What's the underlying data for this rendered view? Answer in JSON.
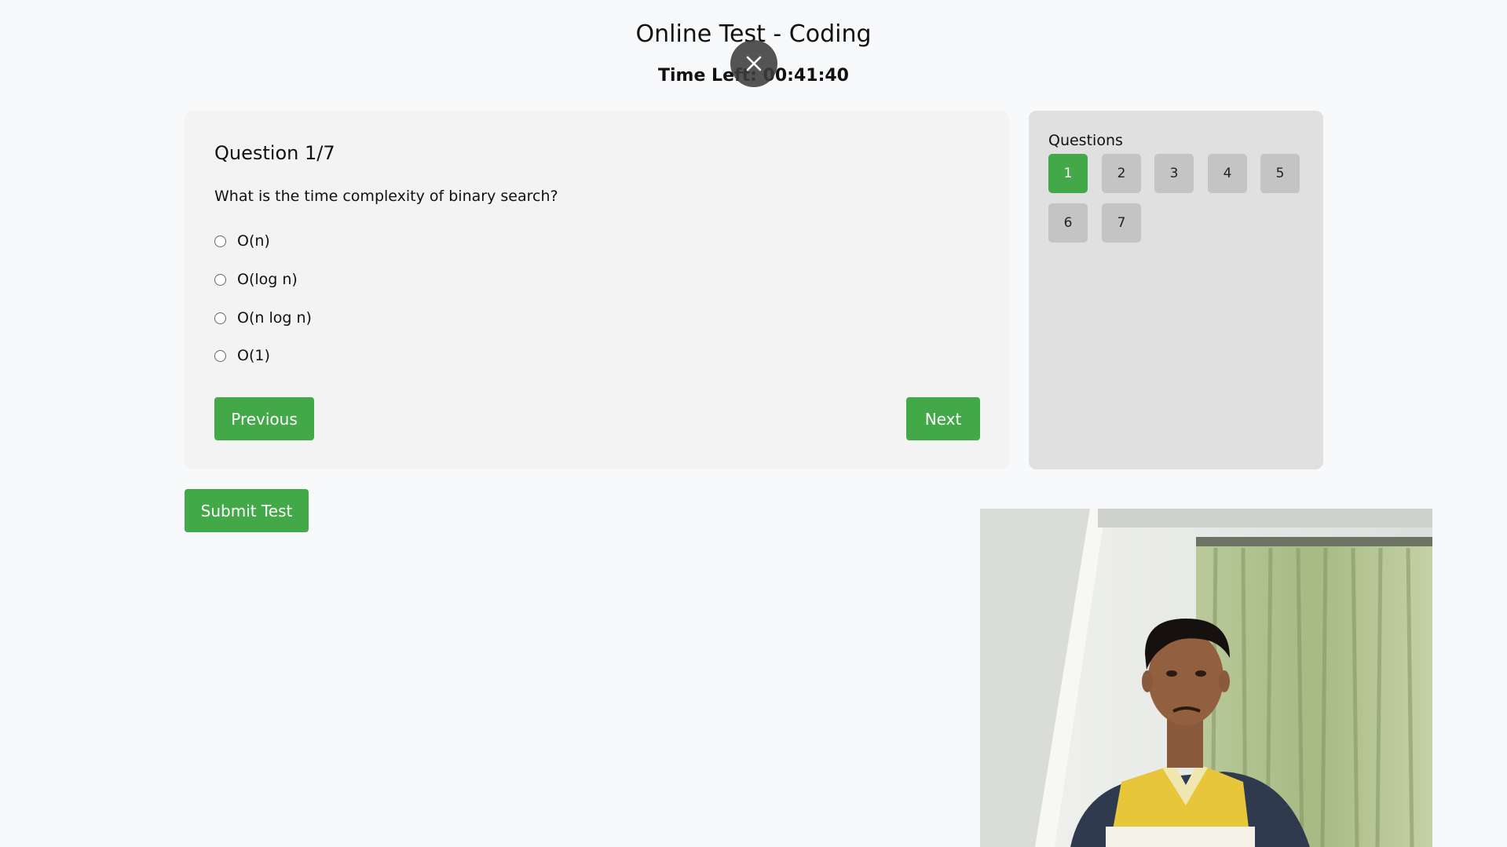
{
  "header": {
    "title": "Online Test - Coding",
    "timer": "Time Left: 00:41:40"
  },
  "question": {
    "number_label": "Question 1/7",
    "text": "What is the time complexity of binary search?",
    "options": [
      "O(n)",
      "O(log n)",
      "O(n log n)",
      "O(1)"
    ]
  },
  "buttons": {
    "previous": "Previous",
    "next": "Next",
    "submit": "Submit Test"
  },
  "navigator": {
    "title": "Questions",
    "items": [
      "1",
      "2",
      "3",
      "4",
      "5",
      "6",
      "7"
    ],
    "active_index": 0
  },
  "colors": {
    "accent": "#43a847",
    "inactive": "#c4c4c4"
  },
  "icons": {
    "close": "close-icon"
  }
}
